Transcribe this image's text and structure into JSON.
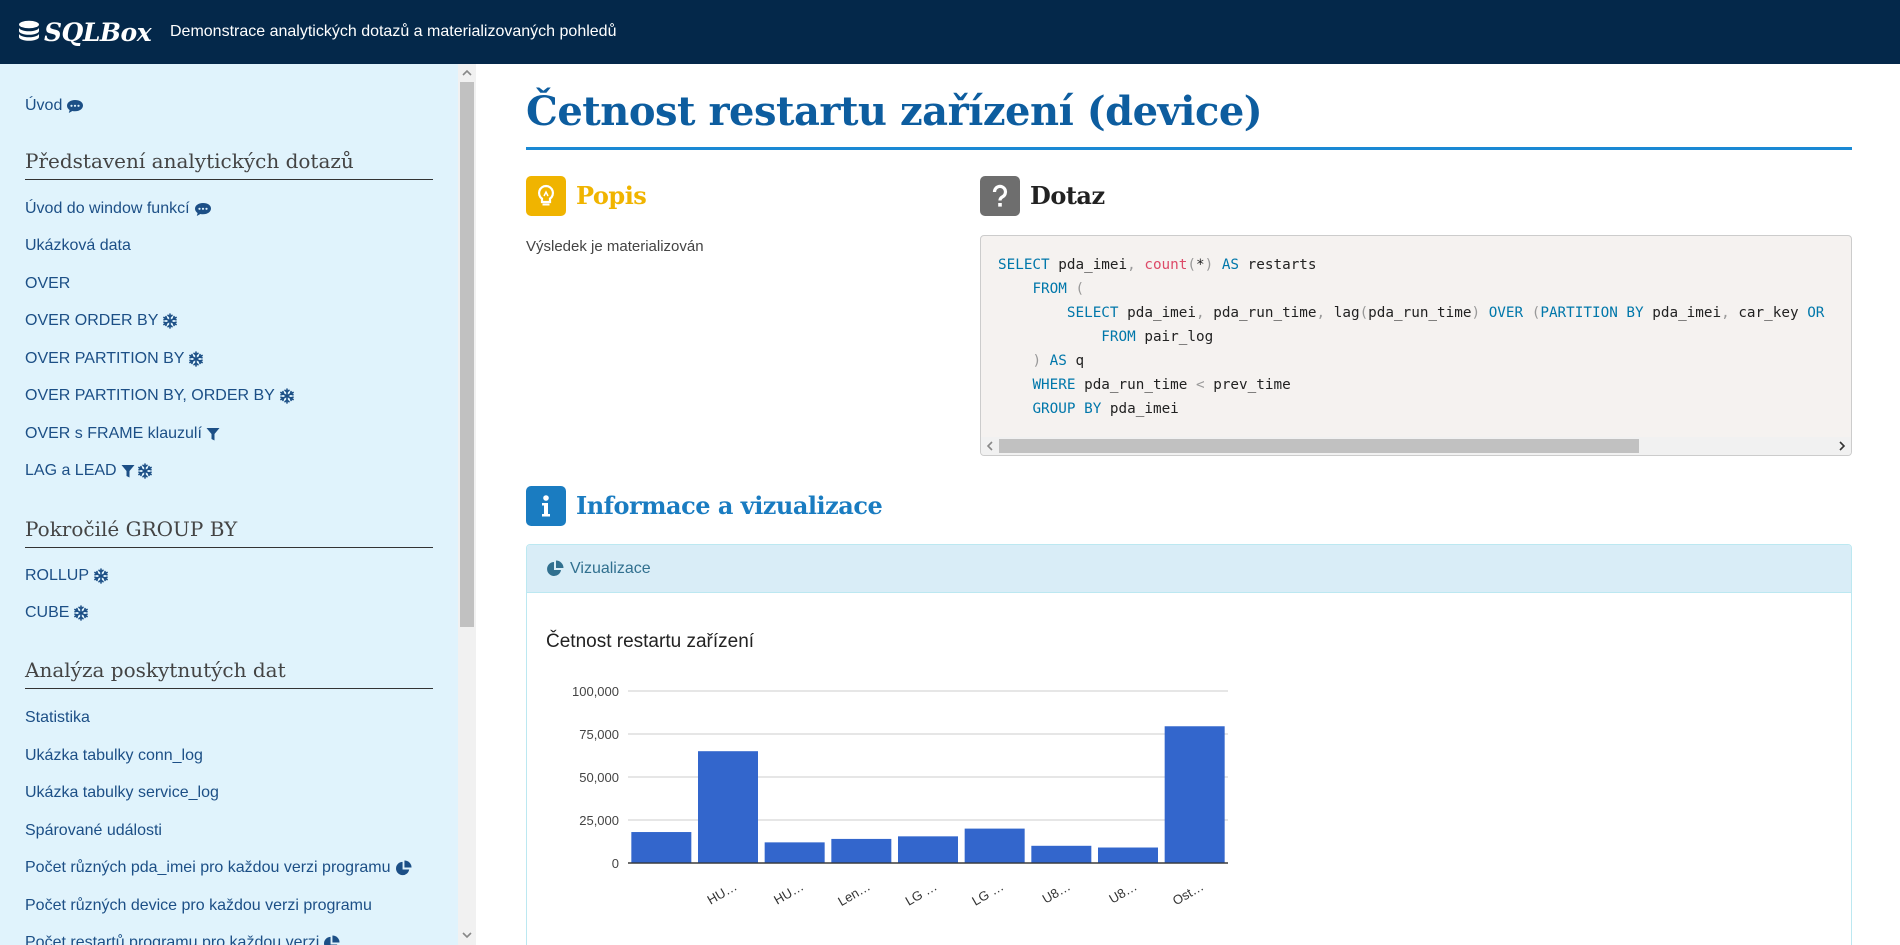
{
  "header": {
    "brand": "SQLBox",
    "subtitle": "Demonstrace analytických dotazů a materializovaných pohledů"
  },
  "sidebar": {
    "intro": "Úvod",
    "sections": [
      {
        "heading": "Představení analytických dotazů",
        "items": [
          {
            "label": "Úvod do window funkcí",
            "icons": [
              "comment-icon"
            ]
          },
          {
            "label": "Ukázková data",
            "icons": []
          },
          {
            "label": "OVER",
            "icons": []
          },
          {
            "label": "OVER ORDER BY",
            "icons": [
              "snowflake-icon"
            ]
          },
          {
            "label": "OVER PARTITION BY",
            "icons": [
              "snowflake-icon"
            ]
          },
          {
            "label": "OVER PARTITION BY, ORDER BY",
            "icons": [
              "snowflake-icon"
            ]
          },
          {
            "label": "OVER s FRAME klauzulí",
            "icons": [
              "filter-icon"
            ]
          },
          {
            "label": "LAG a LEAD",
            "icons": [
              "filter-icon",
              "snowflake-icon"
            ]
          }
        ]
      },
      {
        "heading": "Pokročilé GROUP BY",
        "items": [
          {
            "label": "ROLLUP",
            "icons": [
              "snowflake-icon"
            ]
          },
          {
            "label": "CUBE",
            "icons": [
              "snowflake-icon"
            ]
          }
        ]
      },
      {
        "heading": "Analýza poskytnutých dat",
        "items": [
          {
            "label": "Statistika",
            "icons": []
          },
          {
            "label": "Ukázka tabulky conn_log",
            "icons": []
          },
          {
            "label": "Ukázka tabulky service_log",
            "icons": []
          },
          {
            "label": "Spárované události",
            "icons": []
          },
          {
            "label": "Počet různých pda_imei pro každou verzi programu",
            "icons": [
              "pie-chart-icon"
            ]
          },
          {
            "label": "Počet různých device pro každou verzi programu",
            "icons": []
          },
          {
            "label": "Počet restartů programu pro každou verzi",
            "icons": [
              "pie-chart-icon"
            ]
          }
        ]
      }
    ]
  },
  "main": {
    "title": "Četnost restartu zařízení (device)",
    "description": {
      "title": "Popis",
      "text": "Výsledek je materializován"
    },
    "query": {
      "title": "Dotaz",
      "code_lines": [
        [
          [
            "kw",
            "SELECT"
          ],
          [
            "t",
            " pda_imei"
          ],
          [
            "pn",
            ","
          ],
          [
            "t",
            " "
          ],
          [
            "fn",
            "count"
          ],
          [
            "pn",
            "("
          ],
          [
            "t",
            "*"
          ],
          [
            "pn",
            ")"
          ],
          [
            "t",
            " "
          ],
          [
            "kw",
            "AS"
          ],
          [
            "t",
            " restarts"
          ]
        ],
        [
          [
            "t",
            "    "
          ],
          [
            "kw",
            "FROM"
          ],
          [
            "t",
            " "
          ],
          [
            "pn",
            "("
          ]
        ],
        [
          [
            "t",
            "        "
          ],
          [
            "kw",
            "SELECT"
          ],
          [
            "t",
            " pda_imei"
          ],
          [
            "pn",
            ","
          ],
          [
            "t",
            " pda_run_time"
          ],
          [
            "pn",
            ","
          ],
          [
            "t",
            " lag"
          ],
          [
            "pn",
            "("
          ],
          [
            "t",
            "pda_run_time"
          ],
          [
            "pn",
            ")"
          ],
          [
            "t",
            " "
          ],
          [
            "kw",
            "OVER"
          ],
          [
            "t",
            " "
          ],
          [
            "pn",
            "("
          ],
          [
            "kw",
            "PARTITION BY"
          ],
          [
            "t",
            " pda_imei"
          ],
          [
            "pn",
            ","
          ],
          [
            "t",
            " car_key "
          ],
          [
            "kw",
            "OR"
          ]
        ],
        [
          [
            "t",
            "            "
          ],
          [
            "kw",
            "FROM"
          ],
          [
            "t",
            " pair_log"
          ]
        ],
        [
          [
            "t",
            "    "
          ],
          [
            "pn",
            ")"
          ],
          [
            "t",
            " "
          ],
          [
            "kw",
            "AS"
          ],
          [
            "t",
            " q"
          ]
        ],
        [
          [
            "t",
            "    "
          ],
          [
            "kw",
            "WHERE"
          ],
          [
            "t",
            " pda_run_time "
          ],
          [
            "pn",
            "<"
          ],
          [
            "t",
            " prev_time"
          ]
        ],
        [
          [
            "t",
            "    "
          ],
          [
            "kw",
            "GROUP BY"
          ],
          [
            "t",
            " pda_imei"
          ]
        ]
      ]
    },
    "info": {
      "title": "Informace a vizualizace",
      "panel_title": "Vizualizace"
    }
  },
  "colors": {
    "header_bg": "#04284a",
    "sidebar_bg": "#e0f3fc",
    "link": "#1c4f86",
    "title": "#0d5d9f",
    "popis_accent": "#f0b400",
    "dotaz_badge": "#6e6e6e",
    "info_badge": "#1a7cc1",
    "bar": "#3366cc"
  },
  "chart_data": {
    "type": "bar",
    "title": "Četnost restartu zařízení",
    "categories": [
      "HU…",
      "HU…",
      "Len…",
      "LG …",
      "LG …",
      "U8…",
      "U8…",
      "Ost…"
    ],
    "values": [
      18000,
      65000,
      12000,
      14000,
      15500,
      20000,
      10000,
      9000,
      79500
    ],
    "category_labels_shown": [
      "",
      "HU…",
      "HU…",
      "Len…",
      "LG …",
      "LG …",
      "U8…",
      "U8…",
      "Ost…"
    ],
    "ylim": [
      0,
      100000
    ],
    "yticks": [
      "0",
      "25,000",
      "50,000",
      "75,000",
      "100,000"
    ],
    "ytick_values": [
      0,
      25000,
      50000,
      75000,
      100000
    ],
    "grid": true,
    "legend": "none",
    "bar_color": "#3366cc"
  }
}
